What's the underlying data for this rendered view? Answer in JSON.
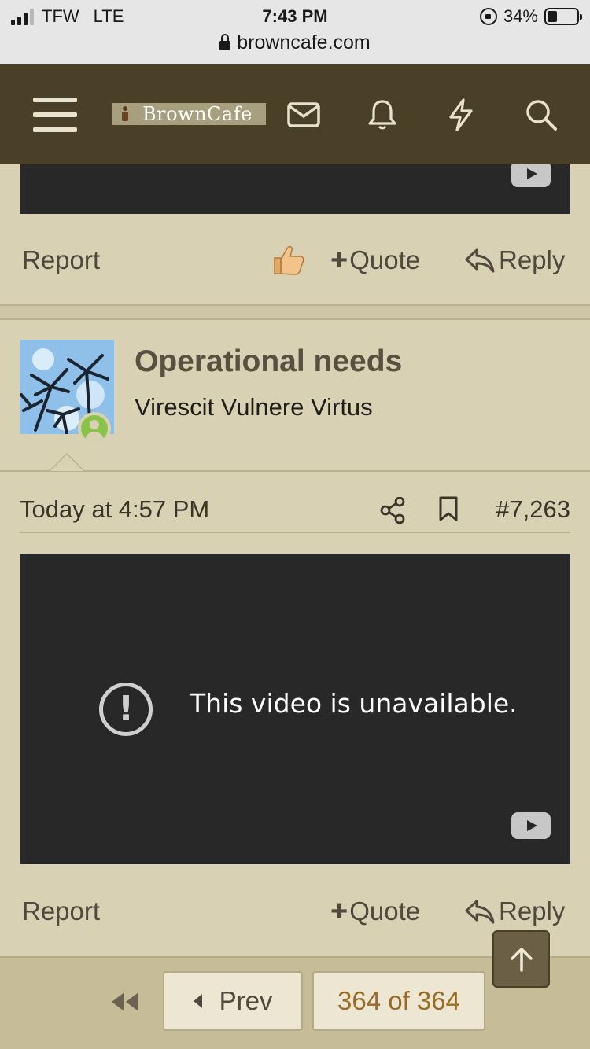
{
  "status_bar": {
    "carrier": "TFW",
    "network": "LTE",
    "time": "7:43 PM",
    "battery": "34%",
    "battery_level": 0.34,
    "url": "browncafe.com"
  },
  "nav": {
    "logo_text": "BrownCafe",
    "icons": [
      "menu-icon",
      "mail-icon",
      "bell-icon",
      "lightning-icon",
      "search-icon"
    ]
  },
  "post_prev": {
    "actions": {
      "report": "Report",
      "quote": "Quote",
      "reply": "Reply"
    }
  },
  "post": {
    "author": "Operational needs",
    "user_title": "Virescit Vulnere Virtus",
    "date": "Today at 4:57 PM",
    "number": "#7,263",
    "video_message": "This video is unavailable.",
    "actions": {
      "report": "Report",
      "quote": "Quote",
      "reply": "Reply"
    }
  },
  "pagination": {
    "prev_label": "Prev",
    "current": "364 of 364"
  },
  "colors": {
    "nav_bg": "#4a4027",
    "page_bg": "#d8d1b3",
    "video_bg": "#282828",
    "current_page": "#9a6b24",
    "online": "#8bc34a"
  }
}
